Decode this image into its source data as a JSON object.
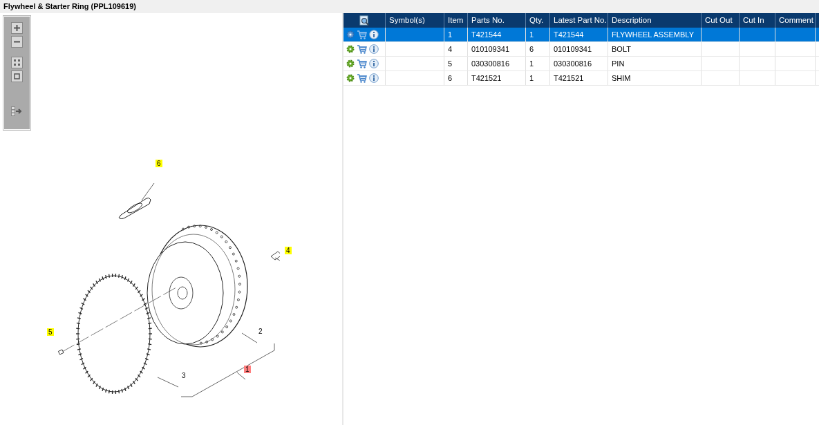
{
  "title": "Flywheel & Starter Ring (PPL109619)",
  "toolbar": {
    "buttons": [
      {
        "kind": "zoom-in"
      },
      {
        "kind": "zoom-out"
      },
      {
        "kind": "fit"
      },
      {
        "kind": "actual"
      },
      {
        "kind": "export"
      }
    ]
  },
  "callouts": [
    {
      "text": "6",
      "color": "#ffff00"
    },
    {
      "text": "4",
      "color": "#ffff00"
    },
    {
      "text": "5",
      "color": "#ffff00"
    },
    {
      "text": "2"
    },
    {
      "text": "1",
      "color": "#ff7f7f"
    },
    {
      "text": "3"
    }
  ],
  "table": {
    "columns": [
      "Symbol(s)",
      "Item",
      "Parts No.",
      "Qty.",
      "Latest Part No.",
      "Description",
      "Cut Out",
      "Cut In",
      "Comment"
    ],
    "rows": [
      {
        "selected": true,
        "item": "1",
        "part_no": "T421544",
        "qty": "1",
        "latest": "T421544",
        "description": "FLYWHEEL ASSEMBLY"
      },
      {
        "selected": false,
        "item": "4",
        "part_no": "010109341",
        "qty": "6",
        "latest": "010109341",
        "description": "BOLT"
      },
      {
        "selected": false,
        "item": "5",
        "part_no": "030300816",
        "qty": "1",
        "latest": "030300816",
        "description": "PIN"
      },
      {
        "selected": false,
        "item": "6",
        "part_no": "T421521",
        "qty": "1",
        "latest": "T421521",
        "description": "SHIM"
      }
    ]
  }
}
